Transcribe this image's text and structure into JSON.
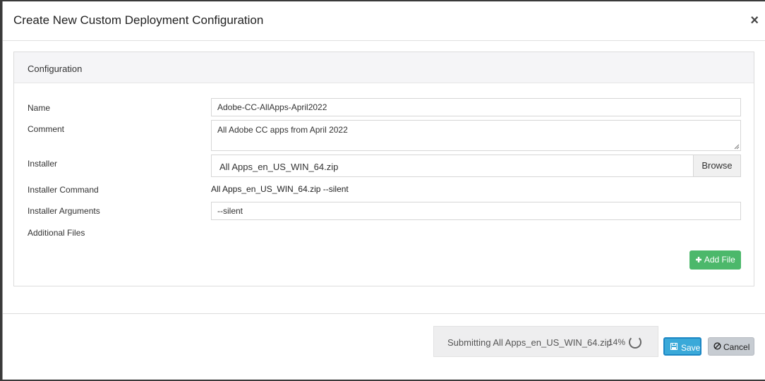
{
  "dialog": {
    "title": "Create New Custom Deployment Configuration",
    "close_glyph": "×"
  },
  "panel": {
    "heading": "Configuration"
  },
  "form": {
    "name_label": "Name",
    "name_value": "Adobe-CC-AllApps-April2022",
    "comment_label": "Comment",
    "comment_value": "All Adobe CC apps from April 2022",
    "installer_label": "Installer",
    "installer_file": "All Apps_en_US_WIN_64.zip",
    "browse_label": "Browse",
    "installer_command_label": "Installer Command",
    "installer_command_value": "All Apps_en_US_WIN_64.zip --silent",
    "installer_arguments_label": "Installer Arguments",
    "installer_arguments_value": "--silent",
    "additional_files_label": "Additional Files",
    "add_file_label": "Add File"
  },
  "footer": {
    "progress_message": "Submitting All Apps_en_US_WIN_64.zip",
    "progress_percent": "14%",
    "progress_fraction": 0.14,
    "save_label": "Save",
    "cancel_label": "Cancel"
  },
  "colors": {
    "add_button": "#4cb86b",
    "save_button": "#3aa9d9",
    "cancel_button": "#c7ccd2"
  },
  "icons": {
    "close": "close-icon",
    "add": "plus-icon",
    "save": "floppy-disk-icon",
    "cancel": "ban-icon",
    "progress": "spinner-icon"
  }
}
